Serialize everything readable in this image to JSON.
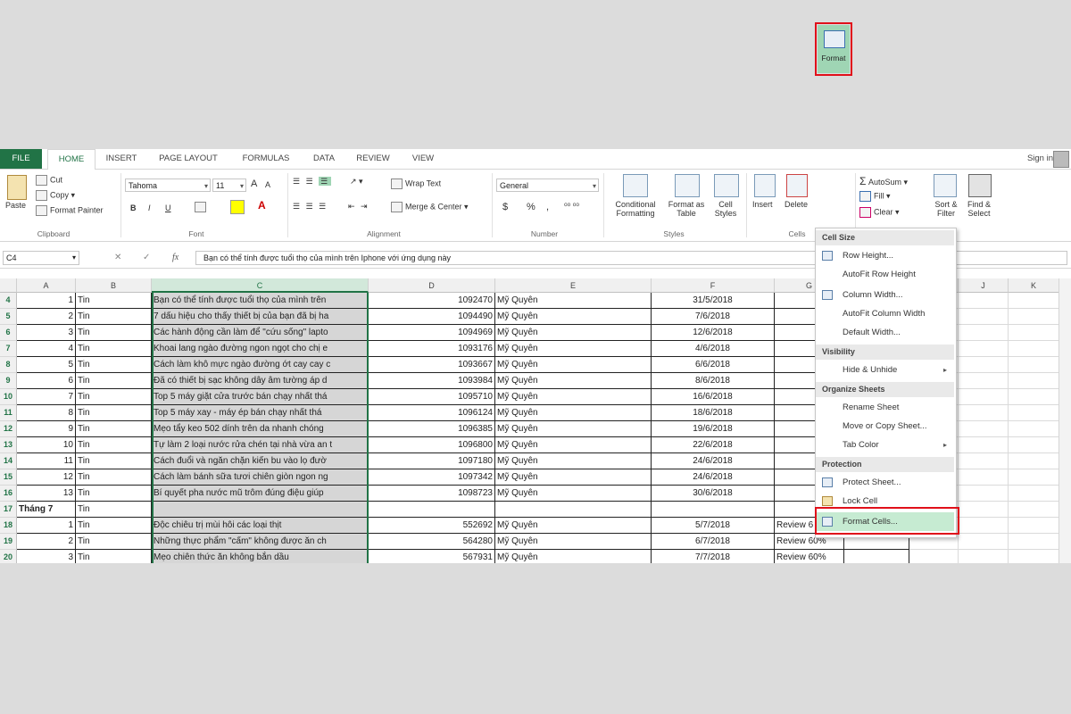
{
  "tabs": [
    "FILE",
    "HOME",
    "INSERT",
    "PAGE LAYOUT",
    "FORMULAS",
    "DATA",
    "REVIEW",
    "VIEW"
  ],
  "account": {
    "signin": "Sign in"
  },
  "ribbon": {
    "clipboard": {
      "paste": "Paste",
      "cut": "Cut",
      "copy": "Copy",
      "format_painter": "Format Painter",
      "label": "Clipboard"
    },
    "font": {
      "name": "Tahoma",
      "size": "11",
      "grow": "A",
      "shrink": "A",
      "bold": "B",
      "italic": "I",
      "underline": "U",
      "font_color_glyph": "A",
      "label": "Font"
    },
    "alignment": {
      "wrap_text": "Wrap Text",
      "merge_center": "Merge & Center",
      "label": "Alignment"
    },
    "number": {
      "format": "General",
      "currency": "$",
      "percent": "%",
      "comma": ",",
      "label": "Number"
    },
    "styles": {
      "conditional": "Conditional",
      "conditional2": "Formatting",
      "format_table": "Format as",
      "format_table2": "Table",
      "cell_styles": "Cell",
      "cell_styles2": "Styles",
      "label": "Styles"
    },
    "cells": {
      "insert": "Insert",
      "delete": "Delete",
      "format": "Format",
      "label": "Cells"
    },
    "editing": {
      "autosum": "AutoSum",
      "fill": "Fill",
      "clear": "Clear",
      "sort": "Sort &",
      "sort2": "Filter",
      "find": "Find &",
      "find2": "Select"
    }
  },
  "formula_bar": {
    "name_box": "C4",
    "content": "Bạn có thể tính được tuổi thọ của mình trên Iphone với ứng dụng này"
  },
  "columns": [
    "A",
    "B",
    "C",
    "D",
    "E",
    "F",
    "G",
    "H",
    "I",
    "J",
    "K"
  ],
  "rows": [
    {
      "n": "4",
      "a": "1",
      "b": "Tin",
      "c": "Bạn có thể tính được tuổi thọ của mình trên",
      "d": "1092470",
      "e": "Mỹ Quyên",
      "f": "31/5/2018",
      "g": ""
    },
    {
      "n": "5",
      "a": "2",
      "b": "Tin",
      "c": "7 dấu hiệu cho thấy thiết bị của bạn đã bị ha",
      "d": "1094490",
      "e": "Mỹ Quyên",
      "f": "7/6/2018",
      "g": ""
    },
    {
      "n": "6",
      "a": "3",
      "b": "Tin",
      "c": "Các hành động cần làm để \"cứu sống\" lapto",
      "d": "1094969",
      "e": "Mỹ Quyên",
      "f": "12/6/2018",
      "g": ""
    },
    {
      "n": "7",
      "a": "4",
      "b": "Tin",
      "c": "Khoai lang ngào đường ngon ngọt cho chị e",
      "d": "1093176",
      "e": "Mỹ Quyên",
      "f": "4/6/2018",
      "g": ""
    },
    {
      "n": "8",
      "a": "5",
      "b": "Tin",
      "c": "Cách làm khô mực ngào đường ớt cay cay c",
      "d": "1093667",
      "e": "Mỹ Quyên",
      "f": "6/6/2018",
      "g": ""
    },
    {
      "n": "9",
      "a": "6",
      "b": "Tin",
      "c": "Đã có thiết bị sạc không dây âm tường áp d",
      "d": "1093984",
      "e": "Mỹ Quyên",
      "f": "8/6/2018",
      "g": ""
    },
    {
      "n": "10",
      "a": "7",
      "b": "Tin",
      "c": "Top 5 máy giặt cửa trước bán chạy nhất thá",
      "d": "1095710",
      "e": "Mỹ Quyên",
      "f": "16/6/2018",
      "g": ""
    },
    {
      "n": "11",
      "a": "8",
      "b": "Tin",
      "c": "Top 5 máy xay - máy ép bán chạy nhất thá",
      "d": "1096124",
      "e": "Mỹ Quyên",
      "f": "18/6/2018",
      "g": ""
    },
    {
      "n": "12",
      "a": "9",
      "b": "Tin",
      "c": "Mẹo tẩy keo 502 dính trên da nhanh chóng",
      "d": "1096385",
      "e": "Mỹ Quyên",
      "f": "19/6/2018",
      "g": ""
    },
    {
      "n": "13",
      "a": "10",
      "b": "Tin",
      "c": "Tự làm 2 loại nước rửa chén tại nhà vừa an t",
      "d": "1096800",
      "e": "Mỹ Quyên",
      "f": "22/6/2018",
      "g": ""
    },
    {
      "n": "14",
      "a": "11",
      "b": "Tin",
      "c": "Cách đuổi và ngăn chặn kiến bu vào lọ đườ",
      "d": "1097180",
      "e": "Mỹ Quyên",
      "f": "24/6/2018",
      "g": ""
    },
    {
      "n": "15",
      "a": "12",
      "b": "Tin",
      "c": "Cách làm bánh sữa tươi chiên giòn ngon ng",
      "d": "1097342",
      "e": "Mỹ Quyên",
      "f": "24/6/2018",
      "g": ""
    },
    {
      "n": "16",
      "a": "13",
      "b": "Tin",
      "c": "Bí quyết pha nước mũ trôm đúng điệu giúp",
      "d": "1098723",
      "e": "Mỹ Quyên",
      "f": "30/6/2018",
      "g": ""
    },
    {
      "n": "17",
      "a": "Tháng 7",
      "b": "Tin",
      "c": "",
      "d": "",
      "e": "",
      "f": "",
      "g": ""
    },
    {
      "n": "18",
      "a": "1",
      "b": "Tin",
      "c": "Độc chiêu trị mùi hôi các loại thịt",
      "d": "552692",
      "e": "Mỹ Quyên",
      "f": "5/7/2018",
      "g": "Review 6"
    },
    {
      "n": "19",
      "a": "2",
      "b": "Tin",
      "c": "Những thực phẩm \"cấm\" không được ăn ch",
      "d": "564280",
      "e": "Mỹ Quyên",
      "f": "6/7/2018",
      "g": "Review 60%"
    },
    {
      "n": "20",
      "a": "3",
      "b": "Tin",
      "c": "Mẹo chiên thức ăn không bắn dầu",
      "d": "567931",
      "e": "Mỹ Quyên",
      "f": "7/7/2018",
      "g": "Review 60%"
    }
  ],
  "format_menu": {
    "cell_size": "Cell Size",
    "row_height": "Row Height...",
    "autofit_row": "AutoFit Row Height",
    "column_width": "Column Width...",
    "autofit_column": "AutoFit Column Width",
    "default_width": "Default Width...",
    "visibility": "Visibility",
    "hide_unhide": "Hide & Unhide",
    "organize": "Organize Sheets",
    "rename": "Rename Sheet",
    "move_copy": "Move or Copy Sheet...",
    "tab_color": "Tab Color",
    "protection": "Protection",
    "protect_sheet": "Protect Sheet...",
    "lock_cell": "Lock Cell",
    "format_cells": "Format Cells..."
  }
}
